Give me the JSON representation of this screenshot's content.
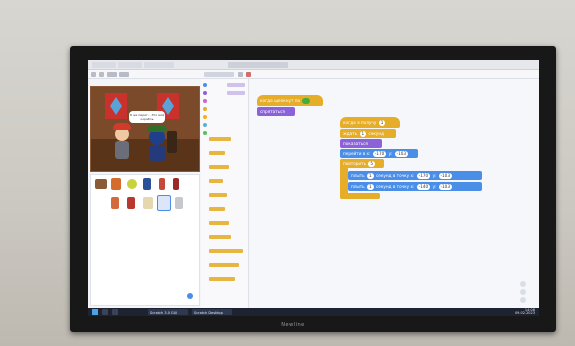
{
  "scratch": {
    "stage": {
      "speech_text": "Я же пират... Это мой корабль"
    },
    "scripts": {
      "script1": {
        "hat": "когда щелкнут по",
        "block": "спрятаться"
      },
      "script2": {
        "hat": "когда я получу",
        "hat_value": "1",
        "wait_label": "ждать",
        "wait_value": "1",
        "wait_suffix": "секунд",
        "show": "показаться",
        "goto_label": "перейти в x:",
        "goto_x": "-170",
        "goto_y_label": "y:",
        "goto_y": "-103",
        "repeat_label": "повторить",
        "repeat_value": "5",
        "glide1_label": "плыть",
        "glide1_secs": "1",
        "glide1_mid": "секунд в точку x:",
        "glide1_x": "-170",
        "glide1_y_label": "y:",
        "glide1_y": "-103",
        "glide2_label": "плыть",
        "glide2_secs": "1",
        "glide2_mid": "секунд в точку x:",
        "glide2_x": "-140",
        "glide2_y_label": "y:",
        "glide2_y": "-103"
      }
    },
    "taskbar": {
      "item1": "Scratch 3.0 GUI",
      "item2": "Scratch Desktop",
      "clock_time": "14:08",
      "clock_date": "09.02.2023"
    }
  },
  "monitor": {
    "brand": "Newline"
  },
  "colors": {
    "events": "#e6ad29",
    "looks": "#8c62d8",
    "motion": "#4b8ee8",
    "stage_wall": "#7a4a2a",
    "curtain": "#c8312c"
  }
}
